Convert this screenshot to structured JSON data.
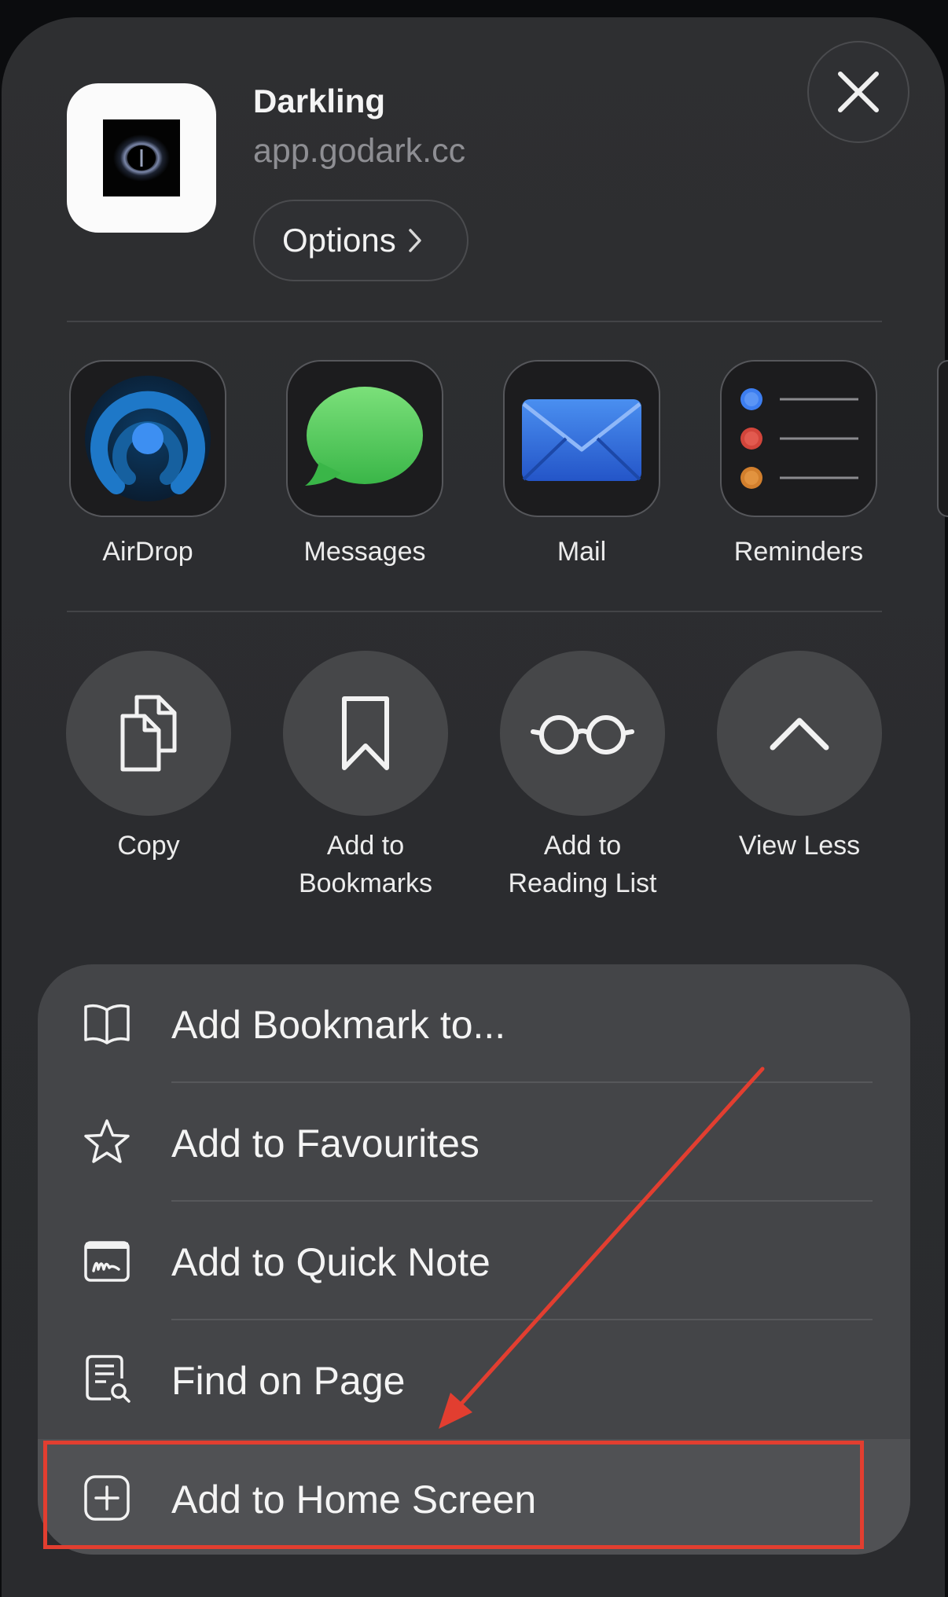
{
  "header": {
    "app_name": "Darkling",
    "url": "app.godark.cc",
    "options_label": "Options",
    "close_icon": "close-icon"
  },
  "share_targets": [
    {
      "label": "AirDrop",
      "icon": "airdrop-icon"
    },
    {
      "label": "Messages",
      "icon": "messages-icon"
    },
    {
      "label": "Mail",
      "icon": "mail-icon"
    },
    {
      "label": "Reminders",
      "icon": "reminders-icon"
    }
  ],
  "actions": [
    {
      "line1": "Copy",
      "line2": "",
      "icon": "copy-icon"
    },
    {
      "line1": "Add to",
      "line2": "Bookmarks",
      "icon": "bookmark-icon"
    },
    {
      "line1": "Add to",
      "line2": "Reading List",
      "icon": "glasses-icon"
    },
    {
      "line1": "View Less",
      "line2": "",
      "icon": "chevron-up-icon"
    }
  ],
  "menu": [
    {
      "label": "Add Bookmark to...",
      "icon": "book-icon"
    },
    {
      "label": "Add to Favourites",
      "icon": "star-icon"
    },
    {
      "label": "Add to Quick Note",
      "icon": "quick-note-icon"
    },
    {
      "label": "Find on Page",
      "icon": "find-on-page-icon"
    },
    {
      "label": "Add to Home Screen",
      "icon": "plus-square-icon"
    }
  ],
  "colors": {
    "annotation": "#e23e30",
    "sheet_background": "#2e2f31",
    "menu_background": "#444548",
    "secondary_text": "#8e8e93"
  }
}
